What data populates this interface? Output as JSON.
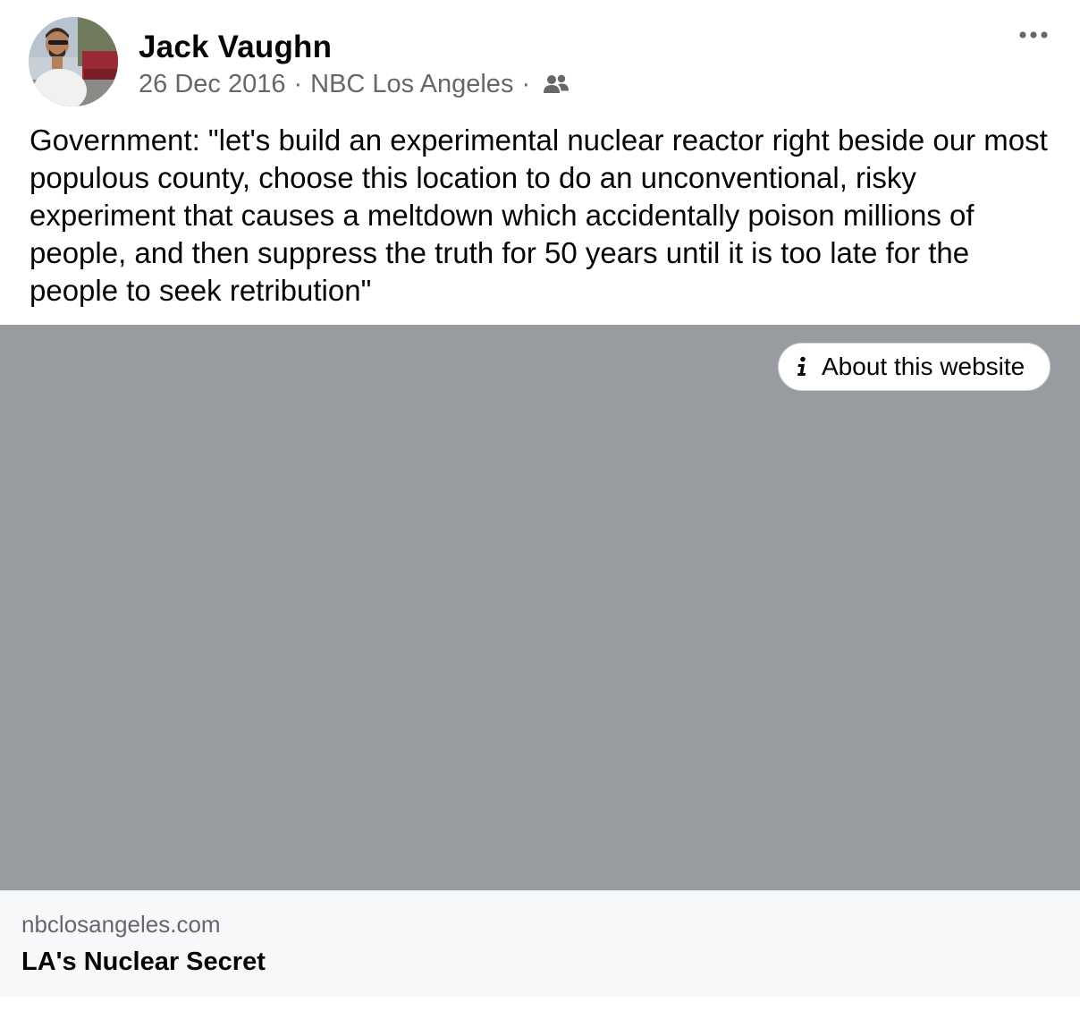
{
  "post": {
    "author": {
      "name": "Jack Vaughn",
      "avatar_icon": "user-avatar-photo"
    },
    "meta": {
      "date": "26 Dec 2016",
      "separator": "·",
      "source": "NBC Los Angeles",
      "audience_icon": "friends-icon"
    },
    "more_icon": "more-horizontal-icon",
    "text": "Government: \"let's build an experimental nuclear reactor right beside our most populous county, choose this location to do an unconventional, risky experiment that causes a meltdown which accidentally poison millions of people, and then suppress the truth for 50 years until it is too late for the people to seek retribution\""
  },
  "link_preview": {
    "about_button": {
      "icon": "info-icon",
      "label": "About this website"
    },
    "domain": "nbclosangeles.com",
    "title": "LA's Nuclear Secret"
  },
  "colors": {
    "text_primary": "#050505",
    "text_secondary": "#65676b",
    "image_placeholder": "#989ba0",
    "footer_background": "#f7f8fa"
  }
}
